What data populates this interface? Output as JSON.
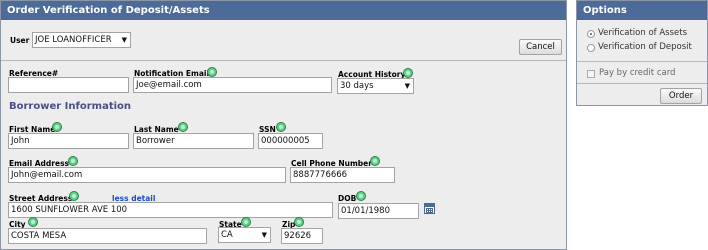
{
  "main": {
    "title": "Order Verification of Deposit/Assets",
    "user": {
      "label": "User",
      "value": "JOE LOANOFFICER"
    },
    "cancel_label": "Cancel",
    "reference": {
      "label": "Reference#",
      "value": ""
    },
    "notification_email": {
      "label": "Notification Email",
      "value": "Joe@email.com"
    },
    "account_history": {
      "label": "Account History",
      "value": "30 days"
    },
    "borrower_section_title": "Borrower Information",
    "first_name": {
      "label": "First Name",
      "value": "John"
    },
    "last_name": {
      "label": "Last Name",
      "value": "Borrower"
    },
    "ssn": {
      "label": "SSN",
      "value": "000000005"
    },
    "email_address": {
      "label": "Email Address",
      "value": "John@email.com"
    },
    "cell_phone": {
      "label": "Cell Phone Number",
      "value": "8887776666"
    },
    "street_address": {
      "label": "Street Address",
      "value": "1600 SUNFLOWER AVE 100"
    },
    "less_detail_label": "less detail",
    "dob": {
      "label": "DOB",
      "value": "01/01/1980"
    },
    "city": {
      "label": "City",
      "value": "COSTA MESA"
    },
    "state": {
      "label": "State",
      "value": "CA"
    },
    "zip": {
      "label": "Zip",
      "value": "92626"
    }
  },
  "options": {
    "title": "Options",
    "verification_of_assets": {
      "label": "Verification of Assets",
      "selected": true
    },
    "verification_of_deposit": {
      "label": "Verification of Deposit",
      "selected": false
    },
    "pay_by_credit_card": {
      "label": "Pay by credit card",
      "checked": false
    },
    "order_label": "Order"
  }
}
